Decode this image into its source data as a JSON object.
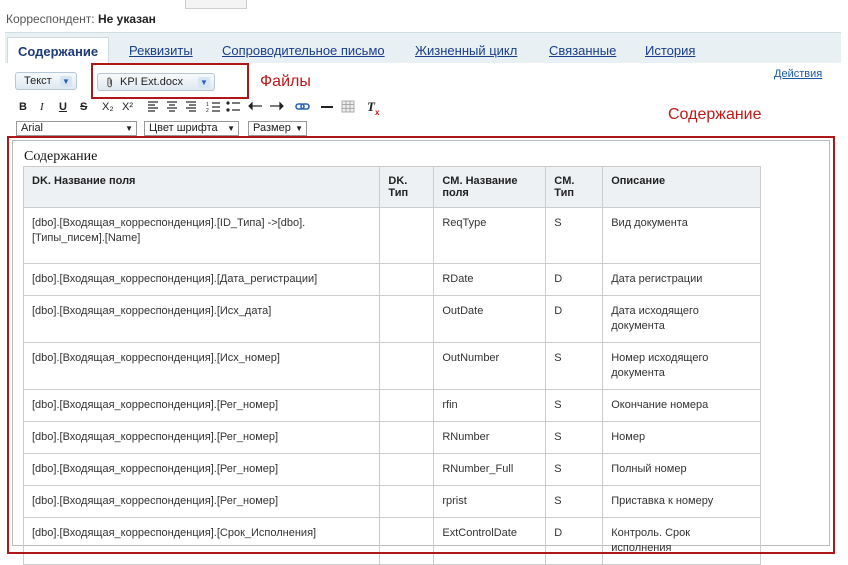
{
  "header": {
    "label": "Корреспондент:",
    "value": "Не указан"
  },
  "tabs": [
    {
      "label": "Содержание"
    },
    {
      "label": "Реквизиты"
    },
    {
      "label": "Сопроводительное письмо"
    },
    {
      "label": "Жизненный цикл"
    },
    {
      "label": "Связанные"
    },
    {
      "label": "История"
    }
  ],
  "actions_link": "Действия",
  "text_dropdown": "Текст",
  "file_chip": "KPI Ext.docx",
  "annotations": {
    "files": "Файлы",
    "content": "Содержание"
  },
  "toolbar": {
    "bold": "B",
    "italic": "I",
    "underline": "U",
    "strike": "S",
    "subscript": "X₂",
    "superscript": "X²",
    "clear_format": "T",
    "font": "Arial",
    "font_color": "Цвет шрифта",
    "size": "Размер"
  },
  "editor": {
    "title": "Содержание",
    "columns": [
      "DK. Название поля",
      "DK. Тип",
      "CM. Название поля",
      "CM. Тип",
      "Описание"
    ],
    "rows": [
      [
        "[dbo].[Входящая_корреспонденция].[ID_Типа] ->[dbo].[Типы_писем].[Name]",
        "",
        "ReqType",
        "S",
        "Вид документа"
      ],
      [
        "[dbo].[Входящая_корреспонденция].[Дата_регистрации]",
        "",
        "RDate",
        "D",
        "Дата регистрации"
      ],
      [
        "[dbo].[Входящая_корреспонденция].[Исх_дата]",
        "",
        "OutDate",
        "D",
        "Дата исходящего документа"
      ],
      [
        "[dbo].[Входящая_корреспонденция].[Исх_номер]",
        "",
        "OutNumber",
        "S",
        "Номер исходящего документа"
      ],
      [
        "[dbo].[Входящая_корреспонденция].[Рег_номер]",
        "",
        "rfin",
        "S",
        "Окончание номера"
      ],
      [
        "[dbo].[Входящая_корреспонденция].[Рег_номер]",
        "",
        "RNumber",
        "S",
        "Номер"
      ],
      [
        "[dbo].[Входящая_корреспонденция].[Рег_номер]",
        "",
        "RNumber_Full",
        "S",
        "Полный номер"
      ],
      [
        "[dbo].[Входящая_корреспонденция].[Рег_номер]",
        "",
        "rprist",
        "S",
        "Приставка к номеру"
      ],
      [
        "[dbo].[Входящая_корреспонденция].[Срок_Исполнения]",
        "",
        "ExtControlDate",
        "D",
        "Контроль. Срок исполнения"
      ]
    ]
  },
  "colors": {
    "accent_red": "#b01818",
    "link": "#1a3e8c",
    "tab_bar": "#e8f0f3"
  }
}
